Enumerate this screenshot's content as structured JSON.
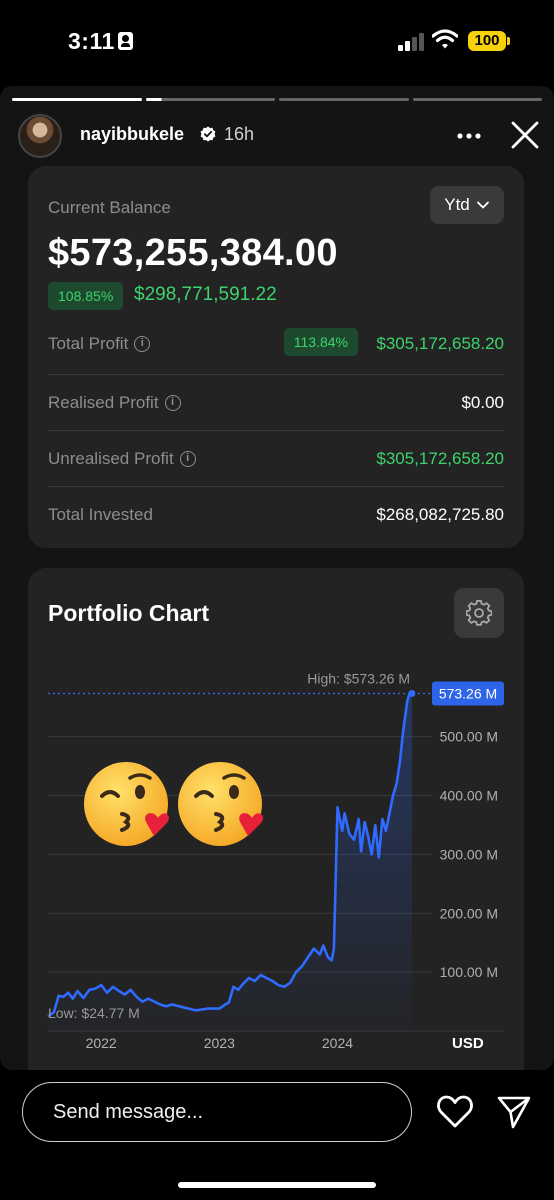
{
  "status_bar": {
    "time": "3:11",
    "battery": "100",
    "icons": [
      "id-card-icon",
      "signal-icon",
      "wifi-icon",
      "battery-icon"
    ]
  },
  "story": {
    "username": "nayibbukele",
    "time_ago": "16h",
    "progress_segments": [
      1,
      0.12,
      0,
      0
    ]
  },
  "balance_card": {
    "label": "Current Balance",
    "period": "Ytd",
    "balance": "$573,255,384.00",
    "change_pct": "108.85%",
    "change_value": "$298,771,591.22",
    "rows": [
      {
        "label": "Total Profit",
        "info": true,
        "badge": "113.84%",
        "value": "$305,172,658.20",
        "color": "green"
      },
      {
        "label": "Realised Profit",
        "info": true,
        "badge": "",
        "value": "$0.00",
        "color": "white"
      },
      {
        "label": "Unrealised Profit",
        "info": true,
        "badge": "",
        "value": "$305,172,658.20",
        "color": "green"
      },
      {
        "label": "Total Invested",
        "info": false,
        "badge": "",
        "value": "$268,082,725.80",
        "color": "white"
      }
    ]
  },
  "chart_card": {
    "title": "Portfolio Chart",
    "high_label": "High: $573.26 M",
    "low_label": "Low: $24.77 M",
    "current_label": "573.26 M",
    "currency": "USD"
  },
  "chart_data": {
    "type": "area",
    "ylim": [
      0,
      620
    ],
    "yticks": [
      {
        "value": 100,
        "label": "100.00 M"
      },
      {
        "value": 200,
        "label": "200.00 M"
      },
      {
        "value": 300,
        "label": "300.00 M"
      },
      {
        "value": 400,
        "label": "400.00 M"
      },
      {
        "value": 500,
        "label": "500.00 M"
      }
    ],
    "xlim": [
      2021.55,
      2024.8
    ],
    "xticks": [
      {
        "value": 2022,
        "label": "2022"
      },
      {
        "value": 2023,
        "label": "2023"
      },
      {
        "value": 2024,
        "label": "2024"
      }
    ],
    "series": [
      {
        "color": "#2f6bff",
        "x": [
          2021.55,
          2021.6,
          2021.64,
          2021.68,
          2021.72,
          2021.76,
          2021.8,
          2021.85,
          2021.9,
          2021.95,
          2022.0,
          2022.05,
          2022.1,
          2022.15,
          2022.2,
          2022.25,
          2022.3,
          2022.35,
          2022.4,
          2022.45,
          2022.5,
          2022.55,
          2022.6,
          2022.7,
          2022.8,
          2022.9,
          2022.95,
          2023.0,
          2023.05,
          2023.08,
          2023.12,
          2023.16,
          2023.2,
          2023.25,
          2023.3,
          2023.35,
          2023.4,
          2023.45,
          2023.5,
          2023.55,
          2023.6,
          2023.65,
          2023.7,
          2023.75,
          2023.8,
          2023.85,
          2023.88,
          2023.92,
          2023.95,
          2023.97,
          2024.0,
          2024.02,
          2024.04,
          2024.06,
          2024.1,
          2024.14,
          2024.18,
          2024.2,
          2024.23,
          2024.26,
          2024.29,
          2024.32,
          2024.35,
          2024.38,
          2024.41,
          2024.44,
          2024.47,
          2024.5,
          2024.53,
          2024.55,
          2024.57,
          2024.59,
          2024.61,
          2024.63
        ],
        "values": [
          24.8,
          32,
          60,
          58,
          65,
          55,
          68,
          56,
          70,
          72,
          78,
          65,
          75,
          68,
          62,
          70,
          58,
          50,
          55,
          50,
          45,
          42,
          45,
          40,
          35,
          38,
          38,
          38,
          45,
          48,
          75,
          70,
          80,
          90,
          85,
          95,
          90,
          85,
          78,
          75,
          82,
          100,
          110,
          125,
          140,
          130,
          145,
          125,
          120,
          140,
          380,
          360,
          340,
          370,
          335,
          325,
          360,
          305,
          355,
          330,
          300,
          350,
          295,
          360,
          340,
          370,
          400,
          420,
          460,
          500,
          530,
          560,
          573.26,
          573.26
        ]
      }
    ]
  },
  "bottom_bar": {
    "message_placeholder": "Send message..."
  }
}
